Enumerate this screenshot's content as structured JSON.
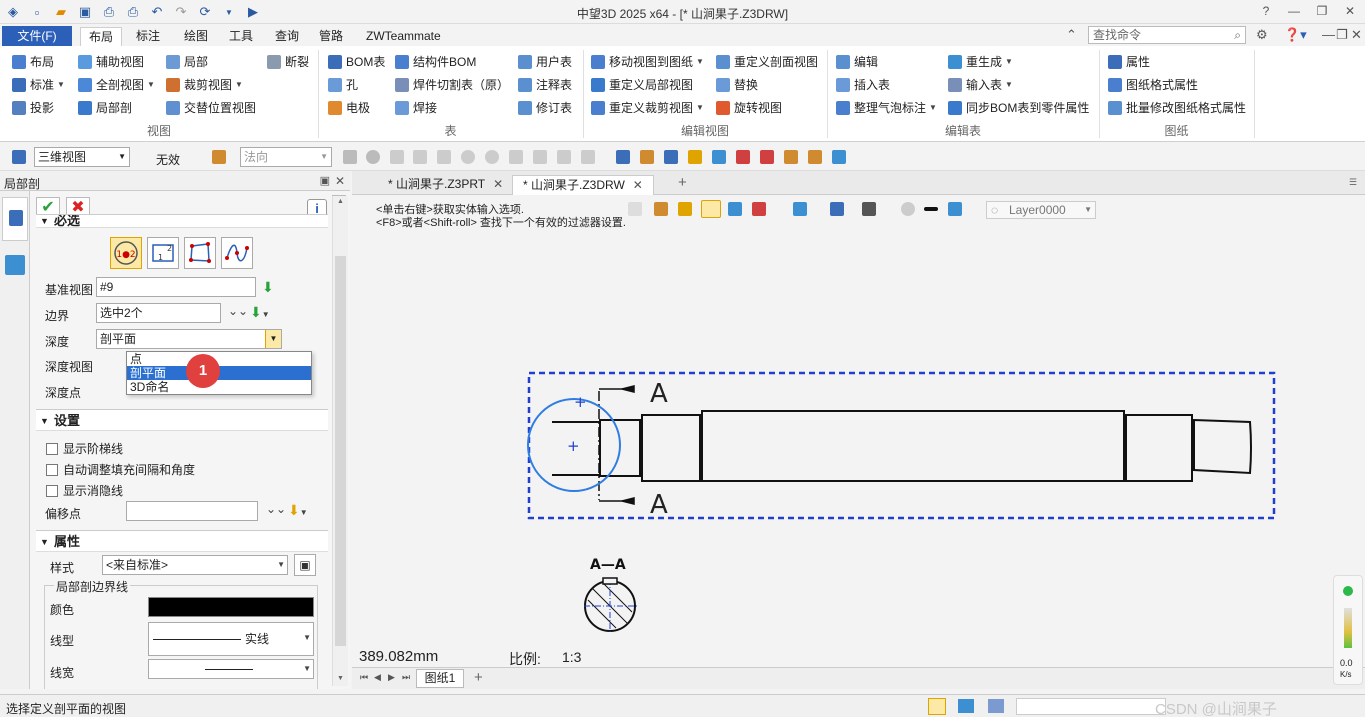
{
  "titlebar": {
    "title": "中望3D 2025 x64 - [* 山涧果子.Z3DRW]"
  },
  "ribbon_tabs": {
    "file": "文件(F)",
    "tabs": [
      "布局",
      "标注",
      "绘图",
      "工具",
      "查询",
      "管路",
      "ZWTeammate"
    ],
    "search_placeholder": "查找命令"
  },
  "ribbon": {
    "view_group": {
      "label": "视图",
      "items": [
        "布局",
        "辅助视图",
        "局部",
        "断裂",
        "标准",
        "全剖视图",
        "裁剪视图",
        "投影",
        "局部剖",
        "交替位置视图"
      ]
    },
    "table_group": {
      "label": "表",
      "items": [
        "BOM表",
        "结构件BOM",
        "用户表",
        "孔",
        "焊件切割表（原）",
        "注释表",
        "电极",
        "焊接",
        "修订表"
      ]
    },
    "edit_view_group": {
      "label": "编辑视图",
      "items": [
        "移动视图到图纸",
        "重定义剖面视图",
        "重定义局部视图",
        "替换",
        "重定义裁剪视图",
        "旋转视图"
      ]
    },
    "edit_table_group": {
      "label": "编辑表",
      "items": [
        "编辑",
        "重生成",
        "插入表",
        "输入表",
        "整理气泡标注",
        "同步BOM表到零件属性"
      ]
    },
    "sheet_group": {
      "label": "图纸",
      "items": [
        "属性",
        "图纸格式属性",
        "批量修改图纸格式属性"
      ]
    }
  },
  "toolbar": {
    "view_combo": "三维视图",
    "invalid": "无效",
    "normal_combo": "法向"
  },
  "panel": {
    "title": "局部剖",
    "section_required": "必选",
    "base_view_label": "基准视图",
    "base_view_value": "#9",
    "boundary_label": "边界",
    "boundary_value": "选中2个",
    "depth_label": "深度",
    "depth_value": "剖平面",
    "depth_view_label": "深度视图",
    "depth_point_label": "深度点",
    "depth_options": [
      "点",
      "剖平面",
      "3D命名"
    ],
    "badge": "1",
    "section_settings": "设置",
    "chk_step": "显示阶梯线",
    "chk_auto": "自动调整填充间隔和角度",
    "chk_hidden": "显示消隐线",
    "offset_label": "偏移点",
    "section_props": "属性",
    "style_label": "样式",
    "style_value": "<来自标准>",
    "boundary_line_group": "局部剖边界线",
    "color_label": "颜色",
    "linetype_label": "线型",
    "linetype_value": "实线",
    "linewidth_label": "线宽"
  },
  "doctabs": {
    "tab1": "* 山涧果子.Z3PRT",
    "tab2": "* 山涧果子.Z3DRW"
  },
  "canvas": {
    "hint1": "<单击右键>获取实体输入选项.",
    "hint2": "<F8>或者<Shift-roll> 查找下一个有效的过滤器设置.",
    "layer": "Layer0000",
    "measure": "389.082mm",
    "scale_label": "比例:",
    "scale_value": "1:3",
    "section_A": "A",
    "section_AA": "A—A"
  },
  "sheetbar": {
    "sheet": "图纸1"
  },
  "statusbar": {
    "message": "选择定义剖平面的视图",
    "watermark": "CSDN @山涧果子"
  },
  "gauge": {
    "value": "0.0",
    "unit": "K/s"
  },
  "colors": {
    "accent": "#2b5fb8",
    "selection_blue": "#1f3fd0",
    "circle_blue": "#2f7de1",
    "badge_red": "#e0413e"
  }
}
